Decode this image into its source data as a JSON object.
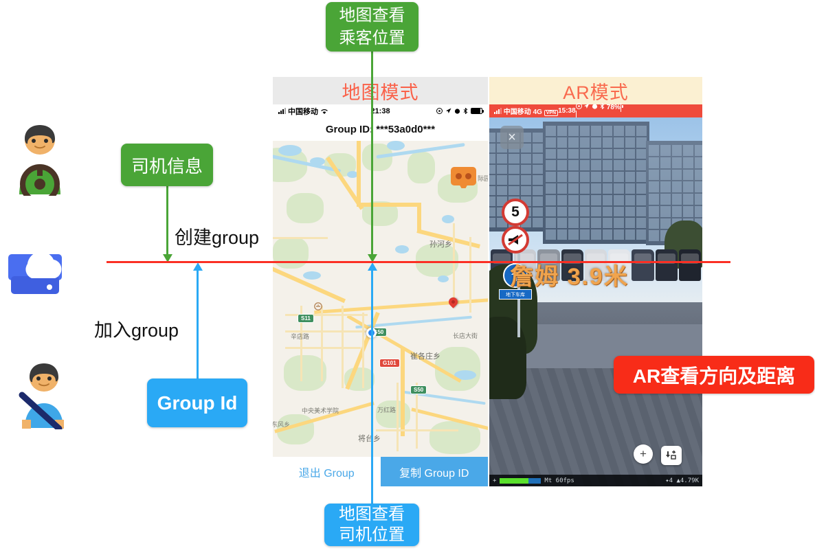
{
  "diagram": {
    "callouts": {
      "top_green": "地图查看\n乘客位置",
      "top_green_l1": "地图查看",
      "top_green_l2": "乘客位置",
      "driver_info": "司机信息",
      "bottom_blue_l1": "地图查看",
      "bottom_blue_l2": "司机位置",
      "group_id": "Group Id",
      "ar_red": "AR查看方向及距离"
    },
    "labels": {
      "create_group": "创建group",
      "join_group": "加入group"
    },
    "actors": {
      "driver": "driver-avatar-icon",
      "cloud": "cloud-database-icon",
      "passenger": "passenger-avatar-icon"
    },
    "colors": {
      "green": "#4aa537",
      "blue": "#2aa9f5",
      "red_line": "#fb2f24",
      "red_box": "#f82c18",
      "header_red": "#fa6149"
    }
  },
  "map_panel": {
    "mode_title": "地图模式",
    "status_bar": {
      "carrier": "中国移动",
      "wifi_icon": "wifi-icon",
      "time": "21:38",
      "icons": [
        "rotation-lock-icon",
        "location-arrow-icon",
        "alarm-icon",
        "bluetooth-icon",
        "battery-icon"
      ]
    },
    "group_id_label": "Group ID: ***53a0d0***",
    "map": {
      "place_labels": [
        "孙河乡",
        "崔各庄乡",
        "将台乡",
        "长店大街",
        "辛店路",
        "万红路",
        "中央美术学院",
        "东风乡"
      ],
      "highway_shields": [
        "S11",
        "S50",
        "G101",
        "S50"
      ],
      "markers": [
        "vr-cardboard-marker",
        "destination-pin",
        "current-location-dot"
      ]
    },
    "buttons": {
      "leave": "退出 Group",
      "copy": "复制 Group ID"
    }
  },
  "ar_panel": {
    "mode_title": "AR模式",
    "status_bar": {
      "carrier": "中国移动",
      "network": "4G",
      "vpn": "VPN",
      "time": "15:38",
      "battery_pct": "78%",
      "icons": [
        "rotation-lock-icon",
        "location-arrow-icon",
        "alarm-icon",
        "bluetooth-icon",
        "battery-icon"
      ]
    },
    "close_button": "×",
    "overlay_text": "詹姆 3.9米",
    "target_name": "詹姆",
    "distance": "3.9米",
    "fab_add": "+",
    "fab_nav": "navigate-icon",
    "dev_bar": {
      "left_plus": "+",
      "label": "Mt 60fps",
      "right": "✦4  ▲4.79K"
    },
    "road_signs": {
      "speed_limit": "5",
      "no_horn": "no-horn-sign",
      "garage_arrow": "地下车库"
    }
  }
}
